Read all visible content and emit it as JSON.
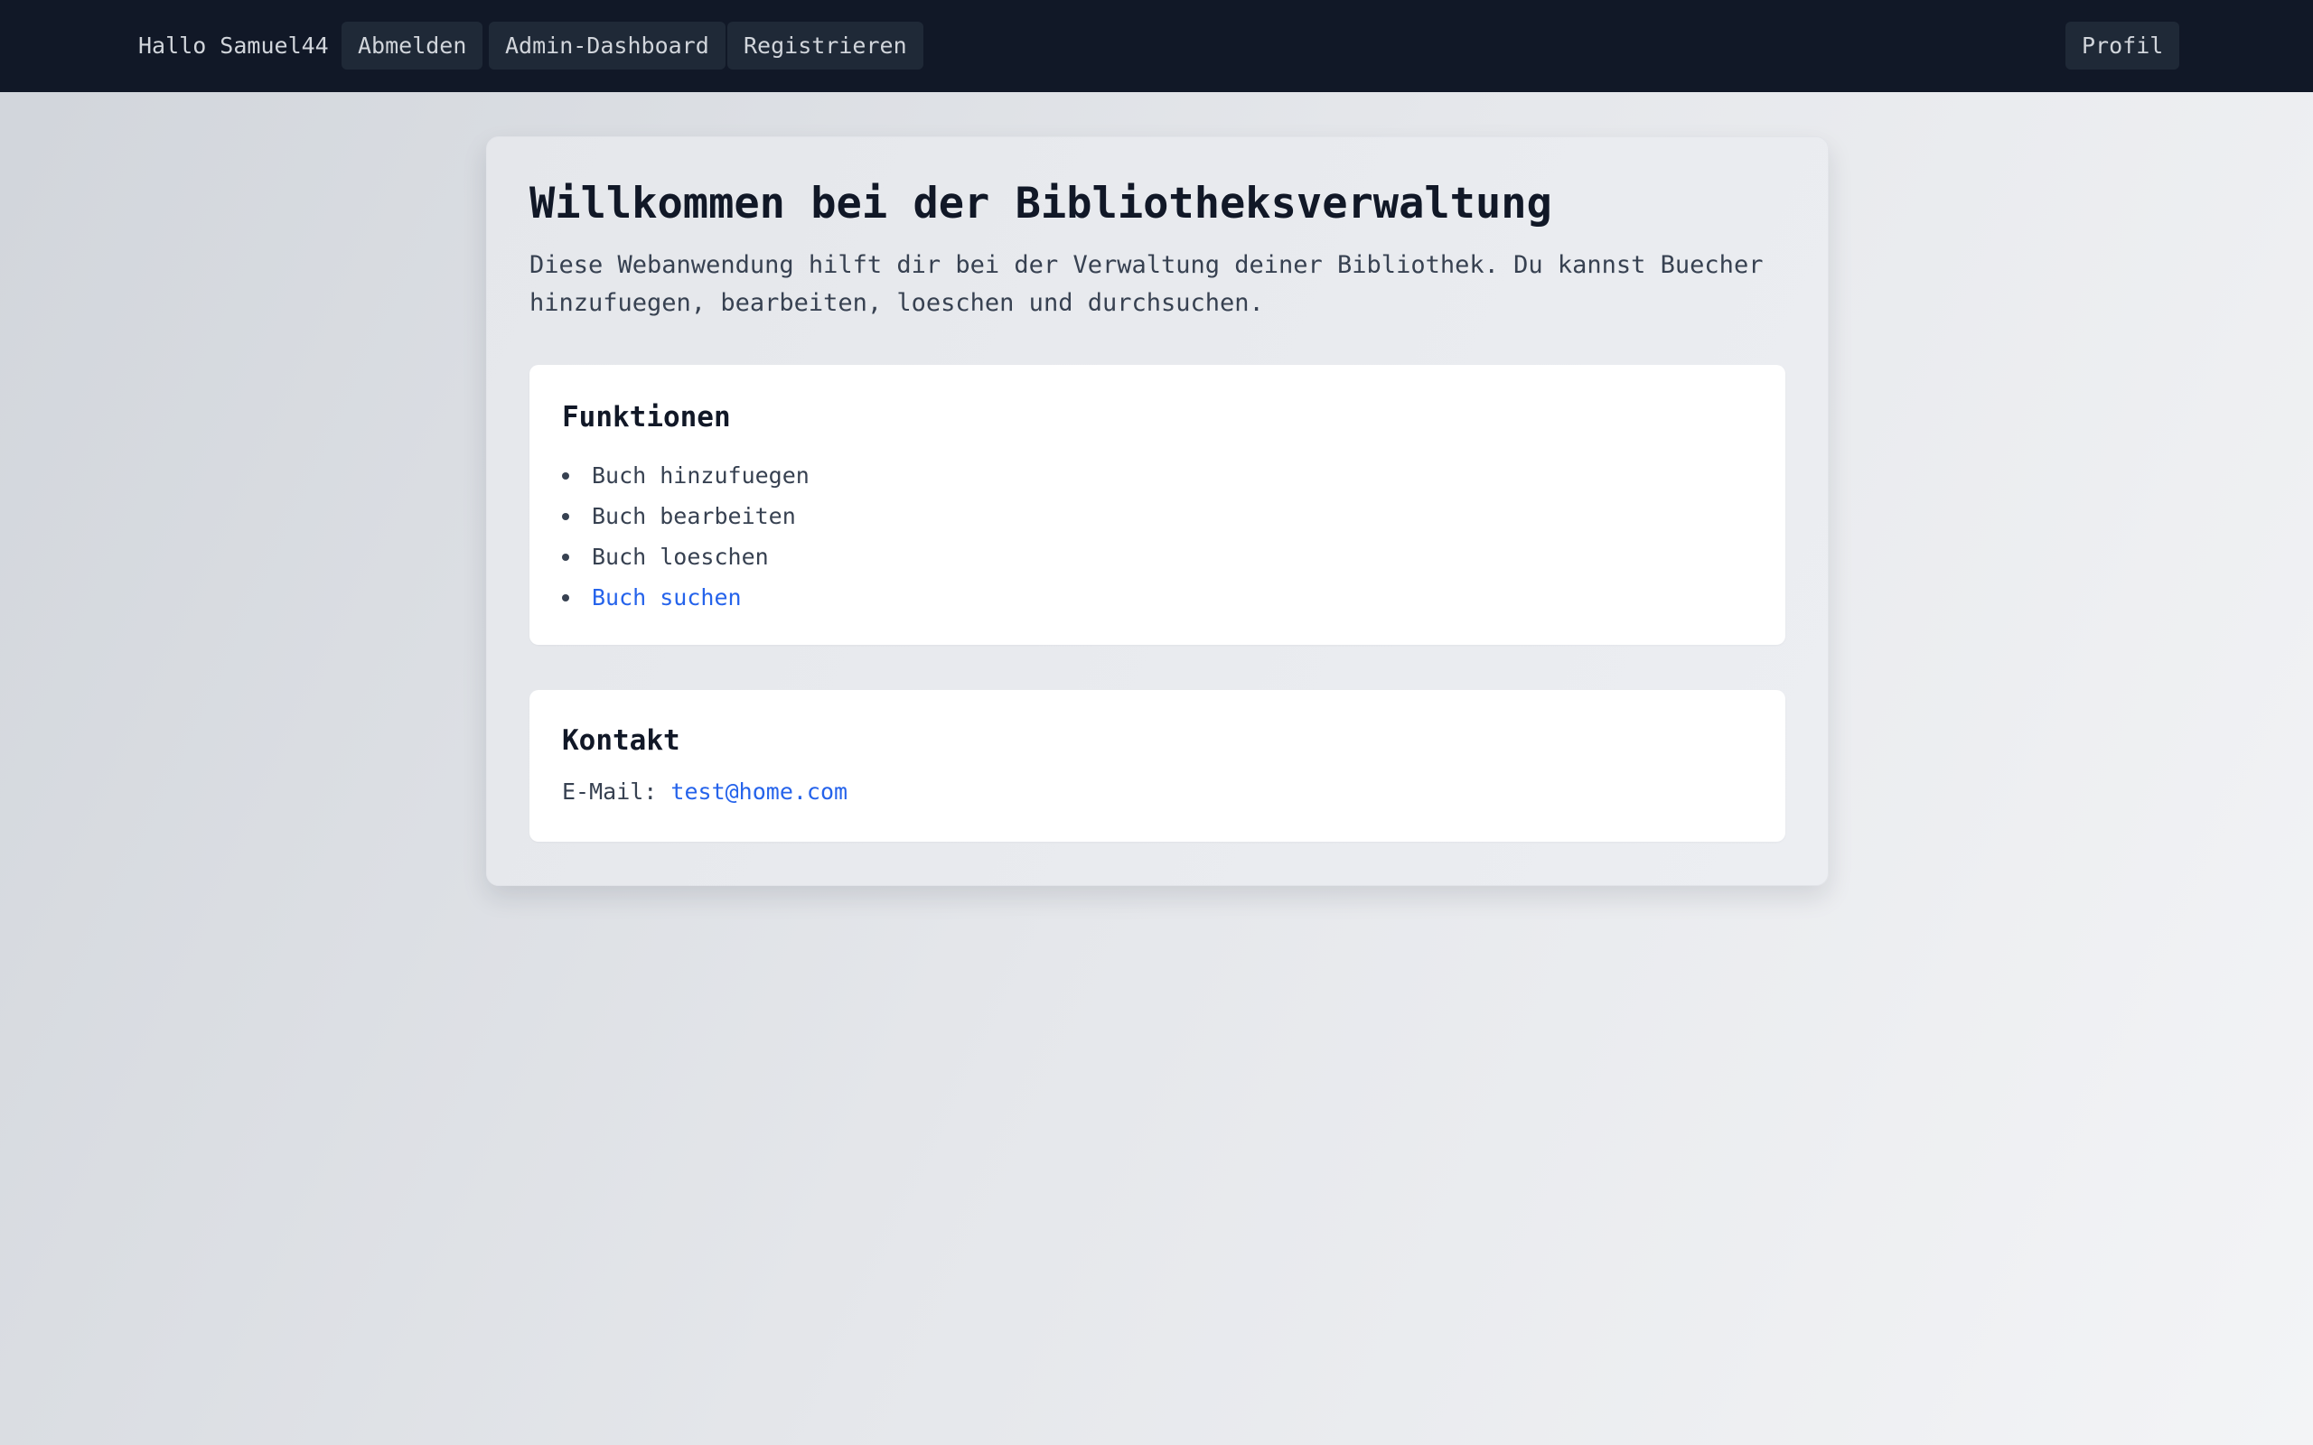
{
  "header": {
    "greeting": "Hallo Samuel44",
    "logout_label": "Abmelden",
    "admin_label": "Admin-Dashboard",
    "register_label": "Registrieren",
    "profile_label": "Profil"
  },
  "main": {
    "title": "Willkommen bei der Bibliotheksverwaltung",
    "intro": "Diese Webanwendung hilft dir bei der Verwaltung deiner Bibliothek. Du kannst Buecher hinzufuegen, bearbeiten, loeschen und durchsuchen.",
    "features": {
      "heading": "Funktionen",
      "items": [
        {
          "label": "Buch hinzufuegen"
        },
        {
          "label": "Buch bearbeiten"
        },
        {
          "label": "Buch loeschen"
        },
        {
          "label": "Buch suchen"
        }
      ]
    },
    "contact": {
      "heading": "Kontakt",
      "email_label": "E-Mail:",
      "email": "test@home.com"
    }
  },
  "colors": {
    "navbar_bg": "#111827",
    "link": "#2563eb",
    "heading": "#111827",
    "text": "#374151"
  }
}
